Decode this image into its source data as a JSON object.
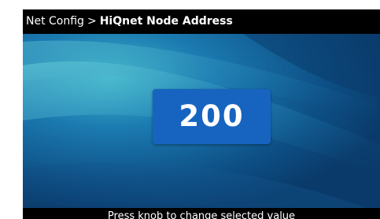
{
  "title_bar": {
    "breadcrumb": "Net Config",
    "separator": ">",
    "current": "HiQnet Node Address"
  },
  "main": {
    "selected_value": "200"
  },
  "status_bar": {
    "hint": "Press knob to change selected value"
  },
  "colors": {
    "background": "#000000",
    "value_box": "#1764c0",
    "wallpaper": "#0d4f85",
    "text": "#ffffff"
  }
}
